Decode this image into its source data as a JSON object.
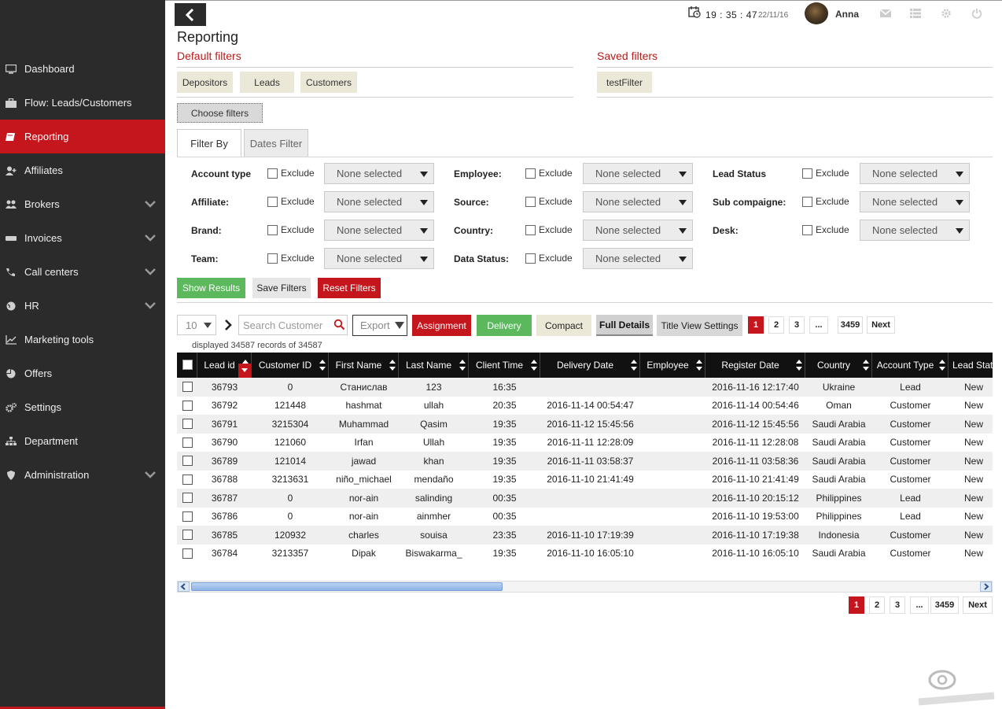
{
  "sidebar": {
    "items": [
      {
        "label": "Dashboard",
        "icon": "monitor-icon",
        "has_chevron": false,
        "active": false
      },
      {
        "label": "Flow: Leads/Customers",
        "icon": "briefcase-icon",
        "has_chevron": false,
        "active": false
      },
      {
        "label": "Reporting",
        "icon": "book-icon",
        "has_chevron": false,
        "active": true
      },
      {
        "label": "Affiliates",
        "icon": "user-plus-icon",
        "has_chevron": false,
        "active": false
      },
      {
        "label": "Brokers",
        "icon": "users-icon",
        "has_chevron": true,
        "active": false
      },
      {
        "label": "Invoices",
        "icon": "invoice-icon",
        "has_chevron": true,
        "active": false
      },
      {
        "label": "Call centers",
        "icon": "phone-icon",
        "has_chevron": true,
        "active": false
      },
      {
        "label": "HR",
        "icon": "globe-icon",
        "has_chevron": true,
        "active": false
      },
      {
        "label": "Marketing tools",
        "icon": "chart-icon",
        "has_chevron": false,
        "active": false
      },
      {
        "label": "Offers",
        "icon": "pie-icon",
        "has_chevron": false,
        "active": false
      },
      {
        "label": "Settings",
        "icon": "gears-icon",
        "has_chevron": false,
        "active": false
      },
      {
        "label": "Department",
        "icon": "sitemap-icon",
        "has_chevron": false,
        "active": false
      },
      {
        "label": "Administration",
        "icon": "shield-icon",
        "has_chevron": true,
        "active": false
      }
    ]
  },
  "header": {
    "time": "19 : 35 : 47",
    "date": "22/11/16",
    "username": "Anna"
  },
  "page_title": "Reporting",
  "default_filters": {
    "title": "Default filters",
    "chips": [
      "Depositors",
      "Leads",
      "Customers"
    ]
  },
  "saved_filters": {
    "title": "Saved filters",
    "chips": [
      "testFilter"
    ]
  },
  "choose_filters_label": "Choose filters",
  "tabs": [
    "Filter By",
    "Dates Filter"
  ],
  "filters": {
    "exclude_label": "Exclude",
    "none_selected": "None selected",
    "col1": [
      "Account type",
      "Affiliate:",
      "Brand:",
      "Team:"
    ],
    "col2": [
      "Employee:",
      "Source:",
      "Country:",
      "Data Status:"
    ],
    "col3": [
      "Lead Status",
      "Sub compaigne:",
      "Desk:"
    ]
  },
  "actions": {
    "show_results": "Show Results",
    "save_filters": "Save Filters",
    "reset_filters": "Reset Filters"
  },
  "toolbar": {
    "per_page": "10",
    "search_placeholder": "Search Customer",
    "export": "Export",
    "assignment": "Assignment",
    "delivery": "Delivery",
    "compact": "Compact",
    "full_details": "Full Details",
    "title_view_settings": "Title View Settings"
  },
  "pagination": [
    "1",
    "2",
    "3",
    "...",
    "3459",
    "Next"
  ],
  "records_text": "displayed 34587 records of 34587",
  "table": {
    "columns": [
      "Lead id",
      "Customer ID",
      "First Name",
      "Last Name",
      "Client Time",
      "Delivery Date",
      "Employee",
      "Register Date",
      "Country",
      "Account Type",
      "Lead Stat"
    ],
    "rows": [
      [
        "36793",
        "0",
        "Станислав",
        "123",
        "16:35",
        "",
        "",
        "2016-11-16 12:17:40",
        "Ukraine",
        "Lead",
        "New"
      ],
      [
        "36792",
        "121448",
        "hashmat",
        "ullah",
        "20:35",
        "2016-11-14 00:54:47",
        "",
        "2016-11-14 00:54:46",
        "Oman",
        "Customer",
        "New"
      ],
      [
        "36791",
        "3215304",
        "Muhammad",
        "Qasim",
        "19:35",
        "2016-11-12 15:45:56",
        "",
        "2016-11-12 15:45:56",
        "Saudi Arabia",
        "Customer",
        "New"
      ],
      [
        "36790",
        "121060",
        "Irfan",
        "Ullah",
        "19:35",
        "2016-11-11 12:28:09",
        "",
        "2016-11-11 12:28:08",
        "Saudi Arabia",
        "Customer",
        "New"
      ],
      [
        "36789",
        "121014",
        "jawad",
        "khan",
        "19:35",
        "2016-11-11 03:58:37",
        "",
        "2016-11-11 03:58:36",
        "Saudi Arabia",
        "Customer",
        "New"
      ],
      [
        "36788",
        "3213631",
        "niño_michael",
        "mendaño",
        "19:35",
        "2016-11-10 21:41:49",
        "",
        "2016-11-10 21:41:49",
        "Saudi Arabia",
        "Customer",
        "New"
      ],
      [
        "36787",
        "0",
        "nor-ain",
        "salinding",
        "00:35",
        "",
        "",
        "2016-11-10 20:15:12",
        "Philippines",
        "Lead",
        "New"
      ],
      [
        "36786",
        "0",
        "nor-ain",
        "ainmher",
        "00:35",
        "",
        "",
        "2016-11-10 19:53:00",
        "Philippines",
        "Lead",
        "New"
      ],
      [
        "36785",
        "120932",
        "charles",
        "souisa",
        "23:35",
        "2016-11-10 17:19:39",
        "",
        "2016-11-10 17:19:38",
        "Indonesia",
        "Customer",
        "New"
      ],
      [
        "36784",
        "3213357",
        "Dipak",
        "Biswakarma_",
        "19:35",
        "2016-11-10 16:05:10",
        "",
        "2016-11-10 16:05:10",
        "Saudi Arabia",
        "Customer",
        "New"
      ]
    ]
  },
  "colors": {
    "sidebar_bg": "#2b2b2b",
    "accent_red": "#c4161c",
    "green": "#5cb85c",
    "chip_beige": "#ebe8d8"
  }
}
